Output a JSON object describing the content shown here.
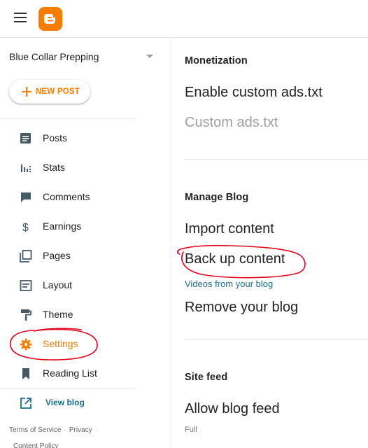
{
  "topbar": {
    "menu_icon": "hamburger-menu-icon",
    "logo_icon": "blogger-logo-icon",
    "brand_color": "#f57d00"
  },
  "sidebar": {
    "blog_name": "Blue Collar Prepping",
    "new_post_label": "NEW POST",
    "items": [
      {
        "label": "Posts",
        "icon": "posts-icon",
        "active": false
      },
      {
        "label": "Stats",
        "icon": "stats-icon",
        "active": false
      },
      {
        "label": "Comments",
        "icon": "comments-icon",
        "active": false
      },
      {
        "label": "Earnings",
        "icon": "dollar-icon",
        "active": false
      },
      {
        "label": "Pages",
        "icon": "pages-icon",
        "active": false
      },
      {
        "label": "Layout",
        "icon": "layout-icon",
        "active": false
      },
      {
        "label": "Theme",
        "icon": "paint-roller-icon",
        "active": false
      },
      {
        "label": "Settings",
        "icon": "gear-icon",
        "active": true
      },
      {
        "label": "Reading List",
        "icon": "bookmark-icon",
        "active": false
      }
    ],
    "view_blog_label": "View blog",
    "footer": {
      "terms": "Terms of Service",
      "privacy": "Privacy",
      "content_policy": "Content Policy",
      "separator": "·"
    }
  },
  "main": {
    "monetization": {
      "title": "Monetization",
      "enable_ads_txt": "Enable custom ads.txt",
      "custom_ads_txt": "Custom ads.txt"
    },
    "manage_blog": {
      "title": "Manage Blog",
      "import_content": "Import content",
      "back_up_content": "Back up content",
      "videos_link": "Videos from your blog",
      "remove_blog": "Remove your blog"
    },
    "site_feed": {
      "title": "Site feed",
      "allow_blog_feed": "Allow blog feed",
      "allow_blog_feed_value": "Full"
    }
  },
  "colors": {
    "accent": "#f57d00",
    "link": "#1a6d86",
    "annotation": "#e0001b"
  }
}
